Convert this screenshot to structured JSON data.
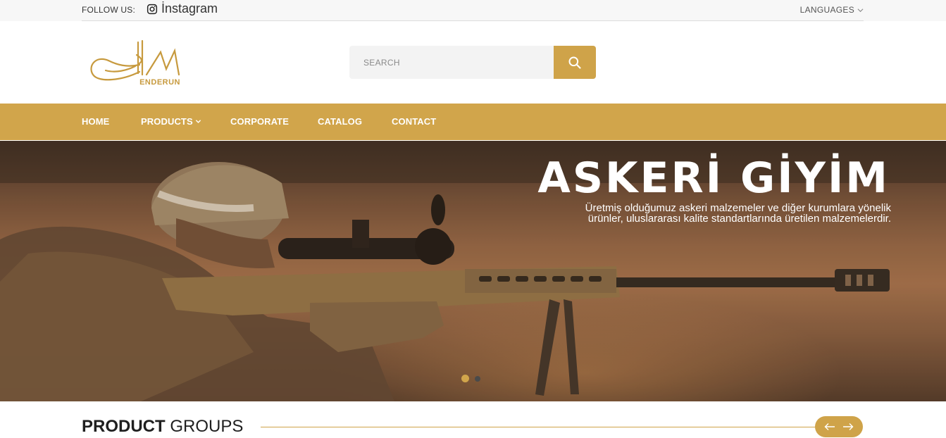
{
  "topbar": {
    "follow_label": "FOLLOW US:",
    "instagram_label": "İnstagram",
    "languages_label": "LANGUAGES"
  },
  "header": {
    "logo_text": "ENDERUN",
    "search_placeholder": "SEARCH"
  },
  "nav": {
    "items": [
      {
        "label": "HOME"
      },
      {
        "label": "PRODUCTS"
      },
      {
        "label": "CORPORATE"
      },
      {
        "label": "CATALOG"
      },
      {
        "label": "CONTACT"
      }
    ]
  },
  "hero": {
    "title": "ASKERİ GİYİM",
    "text": "Üretmiş olduğumuz askeri malzemeler ve diğer kurumlara yönelik ürünler, uluslararası kalite standartlarında üretilen malzemelerdir.",
    "active_slide": 1,
    "slide_count": 2
  },
  "section": {
    "title_bold": "PRODUCT",
    "title_light": "GROUPS"
  },
  "colors": {
    "accent": "#d1a54b",
    "topbar_bg": "#f7f7f7",
    "text_dark": "#1f1f1f"
  }
}
